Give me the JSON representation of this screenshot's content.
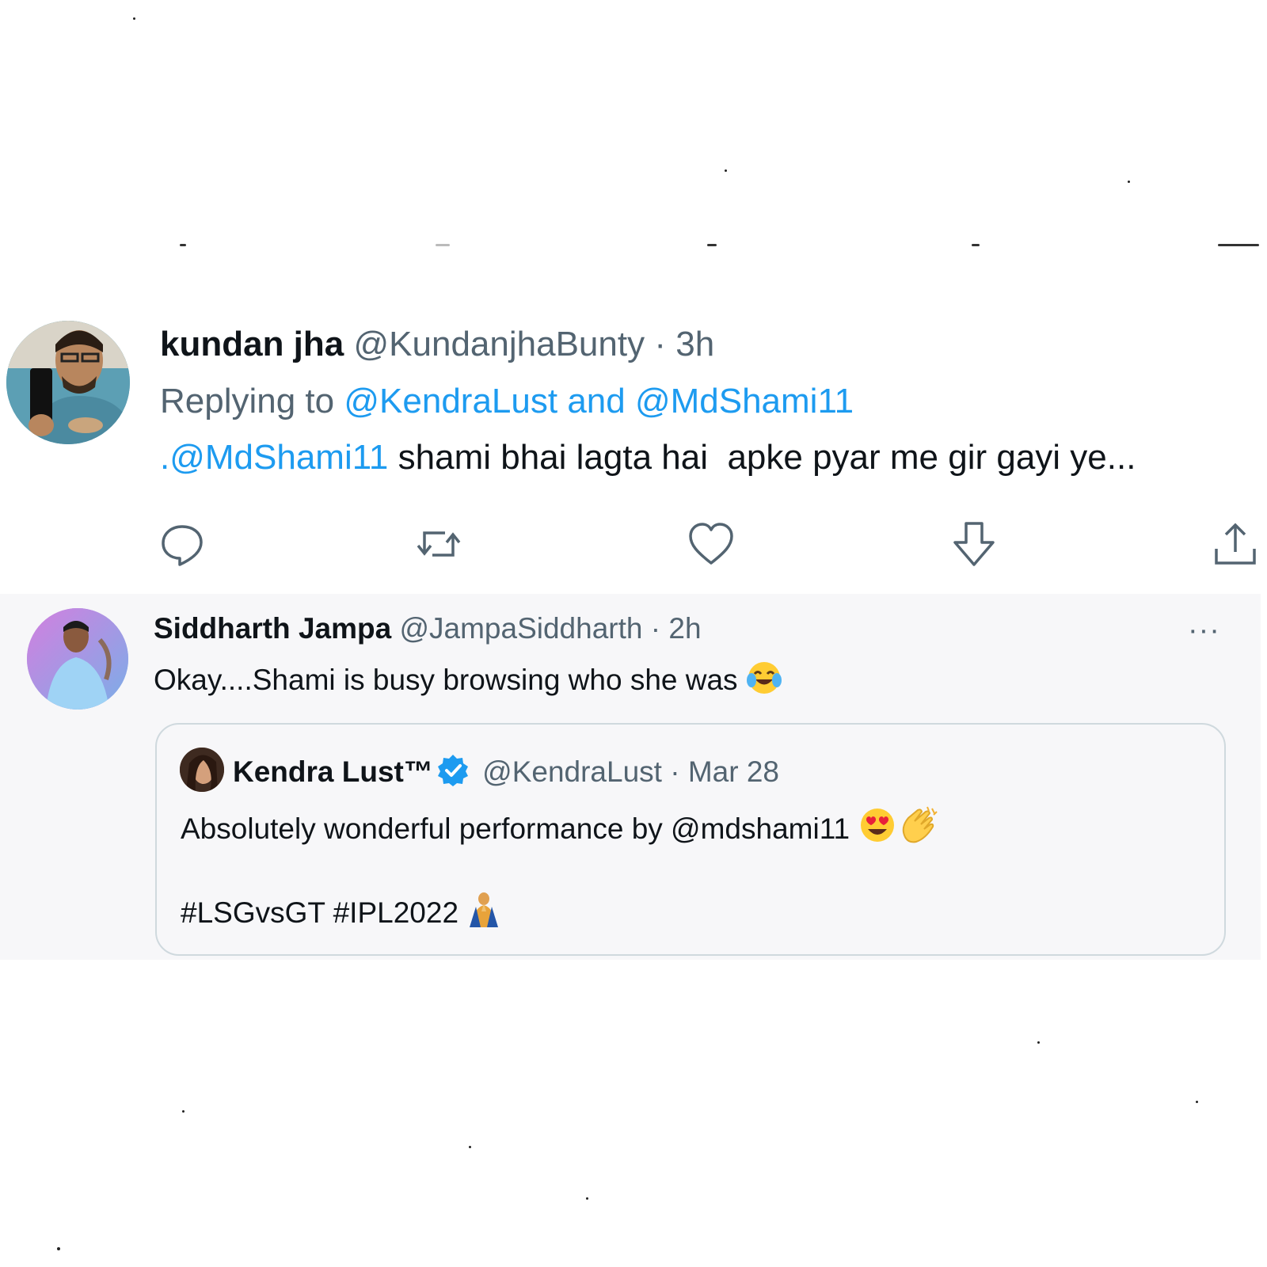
{
  "tweet1": {
    "display_name": "kundan jha",
    "handle": "@KundanjhaBunty",
    "separator": "·",
    "time": "3h",
    "replying_prefix": "Replying to",
    "replying_to": "@KendraLust and @MdShami11",
    "text_mention": ".@MdShami11",
    "text_body": " shami bhai lagta hai  apke pyar me gir gayi ye...",
    "actions": [
      "reply-icon",
      "retweet-icon",
      "like-icon",
      "downvote-icon",
      "share-icon"
    ]
  },
  "tweet2": {
    "display_name": "Siddharth Jampa",
    "handle": "@JampaSiddharth",
    "separator": "·",
    "time": "2h",
    "more": "···",
    "text": "Okay....Shami is busy browsing who she was",
    "emoji": "face-with-tears-of-joy",
    "quoted": {
      "display_name": "Kendra Lust™",
      "verified": true,
      "handle": "@KendraLust",
      "separator": "·",
      "time": "Mar 28",
      "line1": "Absolutely wonderful performance by @mdshami11",
      "line1_emojis": [
        "smiling-face-with-heart-eyes",
        "clapping-hands"
      ],
      "line2": "#LSGvsGT #IPL2022",
      "line2_emoji": "person-with-folded-hands"
    }
  },
  "colors": {
    "link": "#1d9bf0",
    "muted": "#536471",
    "text": "#0f1419",
    "card_bg": "#f7f7f9",
    "border": "#cfd9de"
  }
}
